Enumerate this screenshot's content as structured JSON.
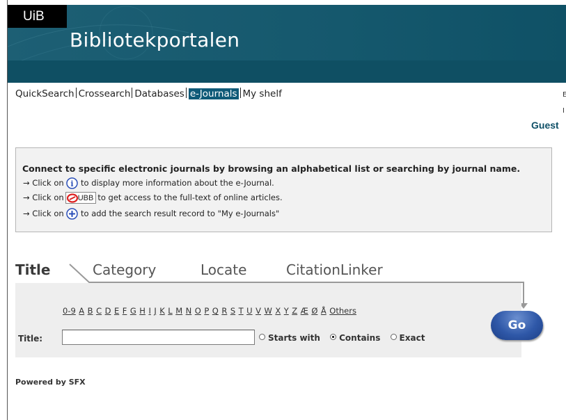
{
  "header": {
    "logo": "UiB",
    "title": "Bibliotekportalen"
  },
  "nav": {
    "items": [
      "QuickSearch",
      "Crossearch",
      "Databases",
      "e-Journals",
      "My shelf"
    ],
    "active_index": 3
  },
  "user": {
    "guest_label": "Guest",
    "edge_1": "E",
    "edge_2": "I"
  },
  "info": {
    "heading": "Connect to specific electronic journals by browsing an alphabetical list or searching by journal name.",
    "line1_prefix": "→ Click on",
    "line1_suffix": "to display more information about the e-Journal.",
    "line2_prefix": "→ Click on",
    "line2_button": "UBB",
    "line2_suffix": "to get access to the full-text of online articles.",
    "line3_prefix": "→ Click on",
    "line3_suffix": "to add the search result record to \"My e-Journals\""
  },
  "tabs": {
    "items": [
      "Title",
      "Category",
      "Locate",
      "CitationLinker"
    ],
    "active_index": 0
  },
  "search": {
    "alphabet": [
      "0-9",
      "A",
      "B",
      "C",
      "D",
      "E",
      "F",
      "G",
      "H",
      "I",
      "J",
      "K",
      "L",
      "M",
      "N",
      "O",
      "P",
      "Q",
      "R",
      "S",
      "T",
      "U",
      "V",
      "W",
      "X",
      "Y",
      "Z",
      "Æ",
      "Ø",
      "Å",
      "Others"
    ],
    "title_label": "Title:",
    "title_value": "",
    "options": [
      "Starts with",
      "Contains",
      "Exact"
    ],
    "selected_option": "Contains",
    "go_label": "Go"
  },
  "footer": {
    "powered_by": "Powered by SFX"
  },
  "colors": {
    "header_bg": "#0f4f63",
    "nav_active_bg": "#0f5a78",
    "guest_text": "#0f5067",
    "go_button": "#2f58a8"
  }
}
